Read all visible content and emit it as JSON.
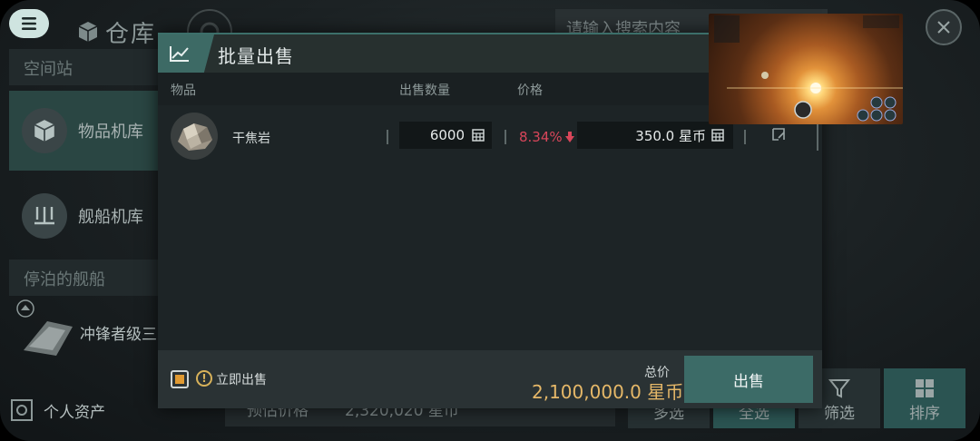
{
  "header": {
    "title": "仓库",
    "search_placeholder": "请输入搜索内容"
  },
  "sidebar": {
    "section_station": "空间站",
    "items": [
      {
        "label": "物品机库"
      },
      {
        "label": "舰船机库"
      }
    ],
    "section_docked": "停泊的舰船",
    "ship_name": "冲锋者级三",
    "personal_assets": "个人资产"
  },
  "behind": {
    "estimate_label": "预估价格",
    "estimate_value": "2,320,020 星币",
    "buttons": [
      "多选",
      "全选",
      "筛选",
      "排序"
    ]
  },
  "modal": {
    "title": "批量出售",
    "columns": {
      "item": "物品",
      "qty": "出售数量",
      "price": "价格"
    },
    "row": {
      "name": "干焦岩",
      "quantity": "6000",
      "percent": "8.34%",
      "price": "350.0 星币"
    },
    "instant_sell": "立即出售",
    "total_label": "总价",
    "total_value": "2,100,000.0 星币",
    "sell_button": "出售"
  },
  "colors": {
    "accent": "#3c6b67",
    "warning": "#d8465a",
    "total": "#e6b868"
  }
}
